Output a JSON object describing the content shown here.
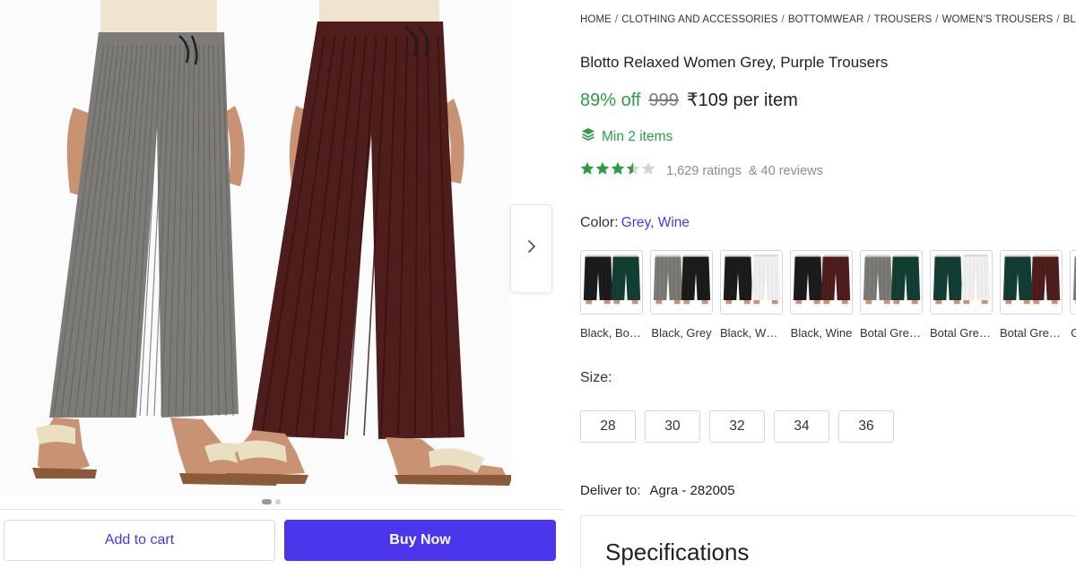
{
  "gallery": {
    "image_alt": "",
    "pants": [
      {
        "color": "#7c7b78",
        "shade": "#5f5e5b"
      },
      {
        "color": "#4e1d1c",
        "shade": "#351111"
      }
    ],
    "skin": "#c99373",
    "sandal": "#e9dfc1",
    "dots_total": 2,
    "dots_active": 0
  },
  "actions": {
    "add_to_cart": "Add to cart",
    "buy_now": "Buy Now"
  },
  "breadcrumb": [
    "HOME",
    "CLOTHING AND ACCESSORIES",
    "BOTTOMWEAR",
    "TROUSERS",
    "WOMEN'S TROUSERS",
    "BLOTTO WOMEN'S TROUSERS"
  ],
  "product": {
    "title": "Blotto Relaxed Women Grey, Purple Trousers",
    "discount": "89% off",
    "mrp": "999",
    "price": "₹109 per item",
    "min_items": "Min 2 items",
    "rating_value": 3.5,
    "ratings_text": "1,629 ratings",
    "reviews_text": "& 40 reviews"
  },
  "color": {
    "label": "Color:",
    "selected": "Grey, Wine",
    "options": [
      {
        "label": "Black, Bottle Green",
        "a": "#1c1c1c",
        "b": "#123f34"
      },
      {
        "label": "Black, Grey",
        "a": "#7c7b78",
        "b": "#1c1c1c"
      },
      {
        "label": "Black, White",
        "a": "#1c1c1c",
        "b": "#efefef"
      },
      {
        "label": "Black, Wine",
        "a": "#1c1c1c",
        "b": "#4e1d1c"
      },
      {
        "label": "Botal Green, Grey",
        "a": "#7c7b78",
        "b": "#123f34"
      },
      {
        "label": "Botal Green, White",
        "a": "#123f34",
        "b": "#efefef"
      },
      {
        "label": "Botal Green, Wine",
        "a": "#123f34",
        "b": "#4e1d1c"
      },
      {
        "label": "Grey, White",
        "a": "#7c7b78",
        "b": "#efefef"
      }
    ]
  },
  "size": {
    "label": "Size:",
    "options": [
      "28",
      "30",
      "32",
      "34",
      "36"
    ]
  },
  "delivery": {
    "label": "Deliver to:",
    "value": "Agra - 282005"
  },
  "specifications": {
    "title": "Specifications"
  },
  "colors": {
    "accent": "#4b36eb",
    "green": "#2a9d45",
    "star": "#2a9d45",
    "star_empty": "#d4d4d4"
  }
}
